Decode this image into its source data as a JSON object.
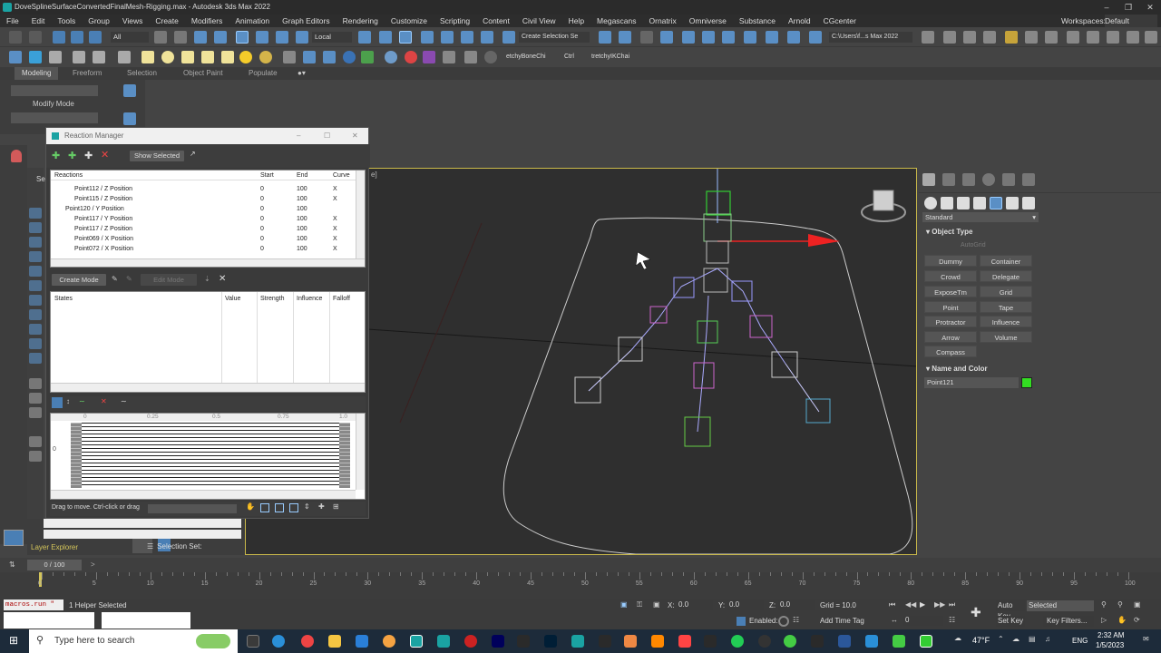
{
  "window": {
    "title": "DoveSplineSurfaceConvertedFinalMesh-Rigging.max - Autodesk 3ds Max 2022"
  },
  "menu": [
    "File",
    "Edit",
    "Tools",
    "Group",
    "Views",
    "Create",
    "Modifiers",
    "Animation",
    "Graph Editors",
    "Rendering",
    "Customize",
    "Scripting",
    "Content",
    "Civil View",
    "Help",
    "Megascans",
    "Ornatrix",
    "Omniverse",
    "Substance",
    "Arnold",
    "CGcenter"
  ],
  "workspaces": {
    "label": "Workspaces:",
    "value": "Default"
  },
  "toolbar": {
    "filter": "All",
    "coord": "Local",
    "selection_set": "Create Selection Se",
    "path": "C:\\Users\\f...s Max 2022",
    "sel1": "etchyBoneChi",
    "sel2": "Ctrl",
    "sel3": "tretchyIKChai"
  },
  "ribbon": {
    "tabs": [
      "Modeling",
      "Freeform",
      "Selection",
      "Object Paint",
      "Populate"
    ],
    "mode": "Modify Mode"
  },
  "reaction_manager": {
    "title": "Reaction Manager",
    "show_selected": "Show Selected",
    "columns": [
      "Reactions",
      "Start",
      "End",
      "Curve"
    ],
    "rows": [
      {
        "name": "Point112 / Z Position",
        "start": "0",
        "end": "100",
        "curve": "X"
      },
      {
        "name": "Point115 / Z Position",
        "start": "0",
        "end": "100",
        "curve": "X"
      },
      {
        "name": "Point120 / Y Position",
        "start": "0",
        "end": "100",
        "curve": ""
      },
      {
        "name": "Point117 / Y Position",
        "start": "0",
        "end": "100",
        "curve": "X"
      },
      {
        "name": "Point117 / Z Position",
        "start": "0",
        "end": "100",
        "curve": "X"
      },
      {
        "name": "Point069 / X Position",
        "start": "0",
        "end": "100",
        "curve": "X"
      },
      {
        "name": "Point072 / X Position",
        "start": "0",
        "end": "100",
        "curve": "X"
      }
    ],
    "create_mode": "Create Mode",
    "edit_mode": "Edit Mode",
    "state_columns": [
      "States",
      "Value",
      "Strength",
      "Influence",
      "Falloff"
    ],
    "curve_ticks": [
      "0",
      "0.25",
      "0.5",
      "0.75",
      "1.0"
    ],
    "curve_y": "0",
    "status": "Drag to move. Ctrl-click or drag"
  },
  "viewport": {
    "label": "e]"
  },
  "command_panel": {
    "dropdown": "Standard",
    "object_type_header": "Object Type",
    "autogrid": "AutoGrid",
    "buttons": [
      "Dummy",
      "Container",
      "Crowd",
      "Delegate",
      "ExposeTm",
      "Grid",
      "Point",
      "Tape",
      "Protractor",
      "Influence",
      "Arrow",
      "Volume",
      "Compass"
    ],
    "name_color_header": "Name and Color",
    "name_value": "Point121",
    "color": "#33dd22"
  },
  "layer": {
    "explorer": "Layer Explorer",
    "selection_set": "Selection Set:"
  },
  "timeline": {
    "frame": "0 / 100",
    "ticks": [
      "0",
      "5",
      "10",
      "15",
      "20",
      "25",
      "30",
      "35",
      "40",
      "45",
      "50",
      "55",
      "60",
      "65",
      "70",
      "75",
      "80",
      "85",
      "90",
      "95",
      "100"
    ]
  },
  "status": {
    "script": "macros.run \"",
    "message": "1 Helper Selected",
    "x_label": "X:",
    "x": "0.0",
    "y_label": "Y:",
    "y": "0.0",
    "z_label": "Z:",
    "z": "0.0",
    "grid": "Grid = 10.0",
    "enabled": "Enabled:",
    "add_time_tag": "Add Time Tag",
    "auto_key": "Auto Key",
    "selected": "Selected",
    "set_key": "Set Key",
    "key_filters": "Key Filters...",
    "frame_field": "0"
  },
  "taskbar": {
    "search": "Type here to search",
    "weather": "47°F",
    "lang": "ENG",
    "time": "2:32 AM",
    "date": "1/5/2023"
  }
}
